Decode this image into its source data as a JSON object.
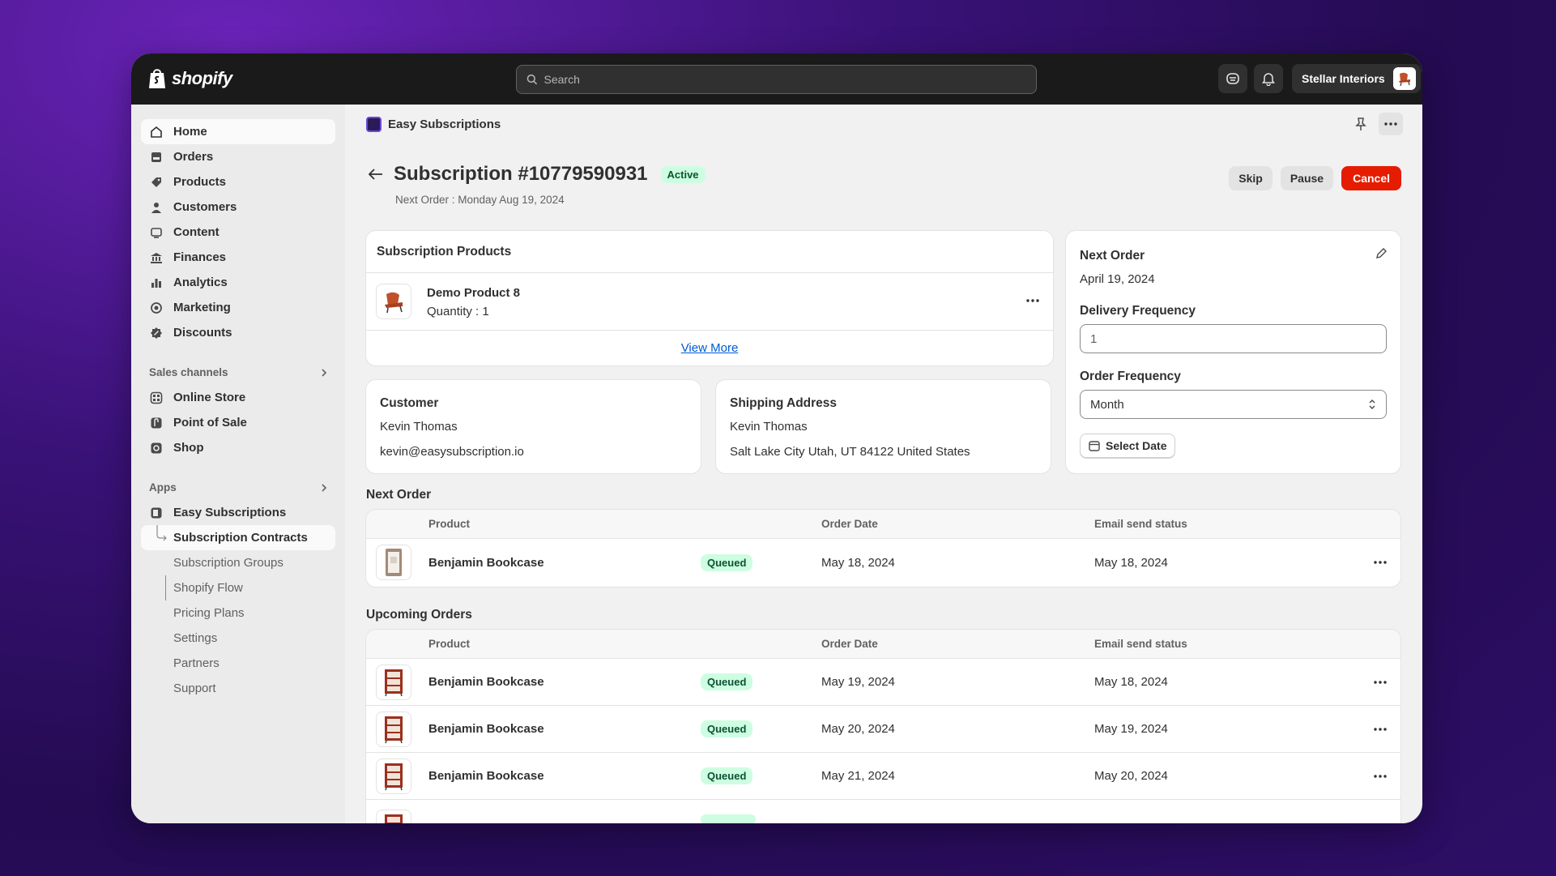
{
  "topbar": {
    "logo_text": "shopify",
    "search_placeholder": "Search",
    "store_name": "Stellar Interiors"
  },
  "sidebar": {
    "items": [
      {
        "label": "Home",
        "icon": "home-icon"
      },
      {
        "label": "Orders",
        "icon": "orders-icon"
      },
      {
        "label": "Products",
        "icon": "tag-icon"
      },
      {
        "label": "Customers",
        "icon": "person-icon"
      },
      {
        "label": "Content",
        "icon": "content-icon"
      },
      {
        "label": "Finances",
        "icon": "bank-icon"
      },
      {
        "label": "Analytics",
        "icon": "bar-chart-icon"
      },
      {
        "label": "Marketing",
        "icon": "target-icon"
      },
      {
        "label": "Discounts",
        "icon": "discount-icon"
      }
    ],
    "sales_channels_heading": "Sales channels",
    "sales_channels": [
      {
        "label": "Online Store"
      },
      {
        "label": "Point of Sale"
      },
      {
        "label": "Shop"
      }
    ],
    "apps_heading": "Apps",
    "app_name": "Easy Subscriptions",
    "app_subitems": [
      "Subscription Contracts",
      "Subscription Groups",
      "Shopify Flow",
      "Pricing Plans",
      "Settings",
      "Partners",
      "Support"
    ]
  },
  "app_header": {
    "title": "Easy Subscriptions"
  },
  "page": {
    "title": "Subscription #10779590931",
    "status": "Active",
    "next_order_line": "Next Order : Monday Aug 19, 2024",
    "actions": {
      "skip": "Skip",
      "pause": "Pause",
      "cancel": "Cancel"
    }
  },
  "subscription_products": {
    "heading": "Subscription Products",
    "product_name": "Demo Product 8",
    "quantity": "Quantity : 1",
    "view_more": "View More"
  },
  "customer": {
    "heading": "Customer",
    "name": "Kevin Thomas",
    "email": "kevin@easysubscription.io"
  },
  "shipping": {
    "heading": "Shipping Address",
    "name": "Kevin Thomas",
    "address": "Salt Lake City Utah, UT 84122 United States"
  },
  "next_order_panel": {
    "heading": "Next Order",
    "date": "April 19, 2024",
    "delivery_frequency_label": "Delivery Frequency",
    "delivery_frequency_value": "1",
    "order_frequency_label": "Order Frequency",
    "order_frequency_value": "Month",
    "select_date": "Select Date"
  },
  "table_headers": {
    "product": "Product",
    "order_date": "Order Date",
    "email_status": "Email send status"
  },
  "next_order_section": {
    "heading": "Next Order",
    "rows": [
      {
        "product": "Benjamin Bookcase",
        "status": "Queued",
        "order_date": "May 18, 2024",
        "email_status": "May 18, 2024"
      }
    ]
  },
  "upcoming_orders_section": {
    "heading": "Upcoming Orders",
    "rows": [
      {
        "product": "Benjamin Bookcase",
        "status": "Queued",
        "order_date": "May 19, 2024",
        "email_status": "May 18, 2024"
      },
      {
        "product": "Benjamin Bookcase",
        "status": "Queued",
        "order_date": "May 20, 2024",
        "email_status": "May 19, 2024"
      },
      {
        "product": "Benjamin Bookcase",
        "status": "Queued",
        "order_date": "May 21, 2024",
        "email_status": "May 20, 2024"
      }
    ]
  },
  "colors": {
    "accent_danger": "#e51c00",
    "badge_success_bg": "#cdfee1",
    "link": "#005bd3"
  }
}
